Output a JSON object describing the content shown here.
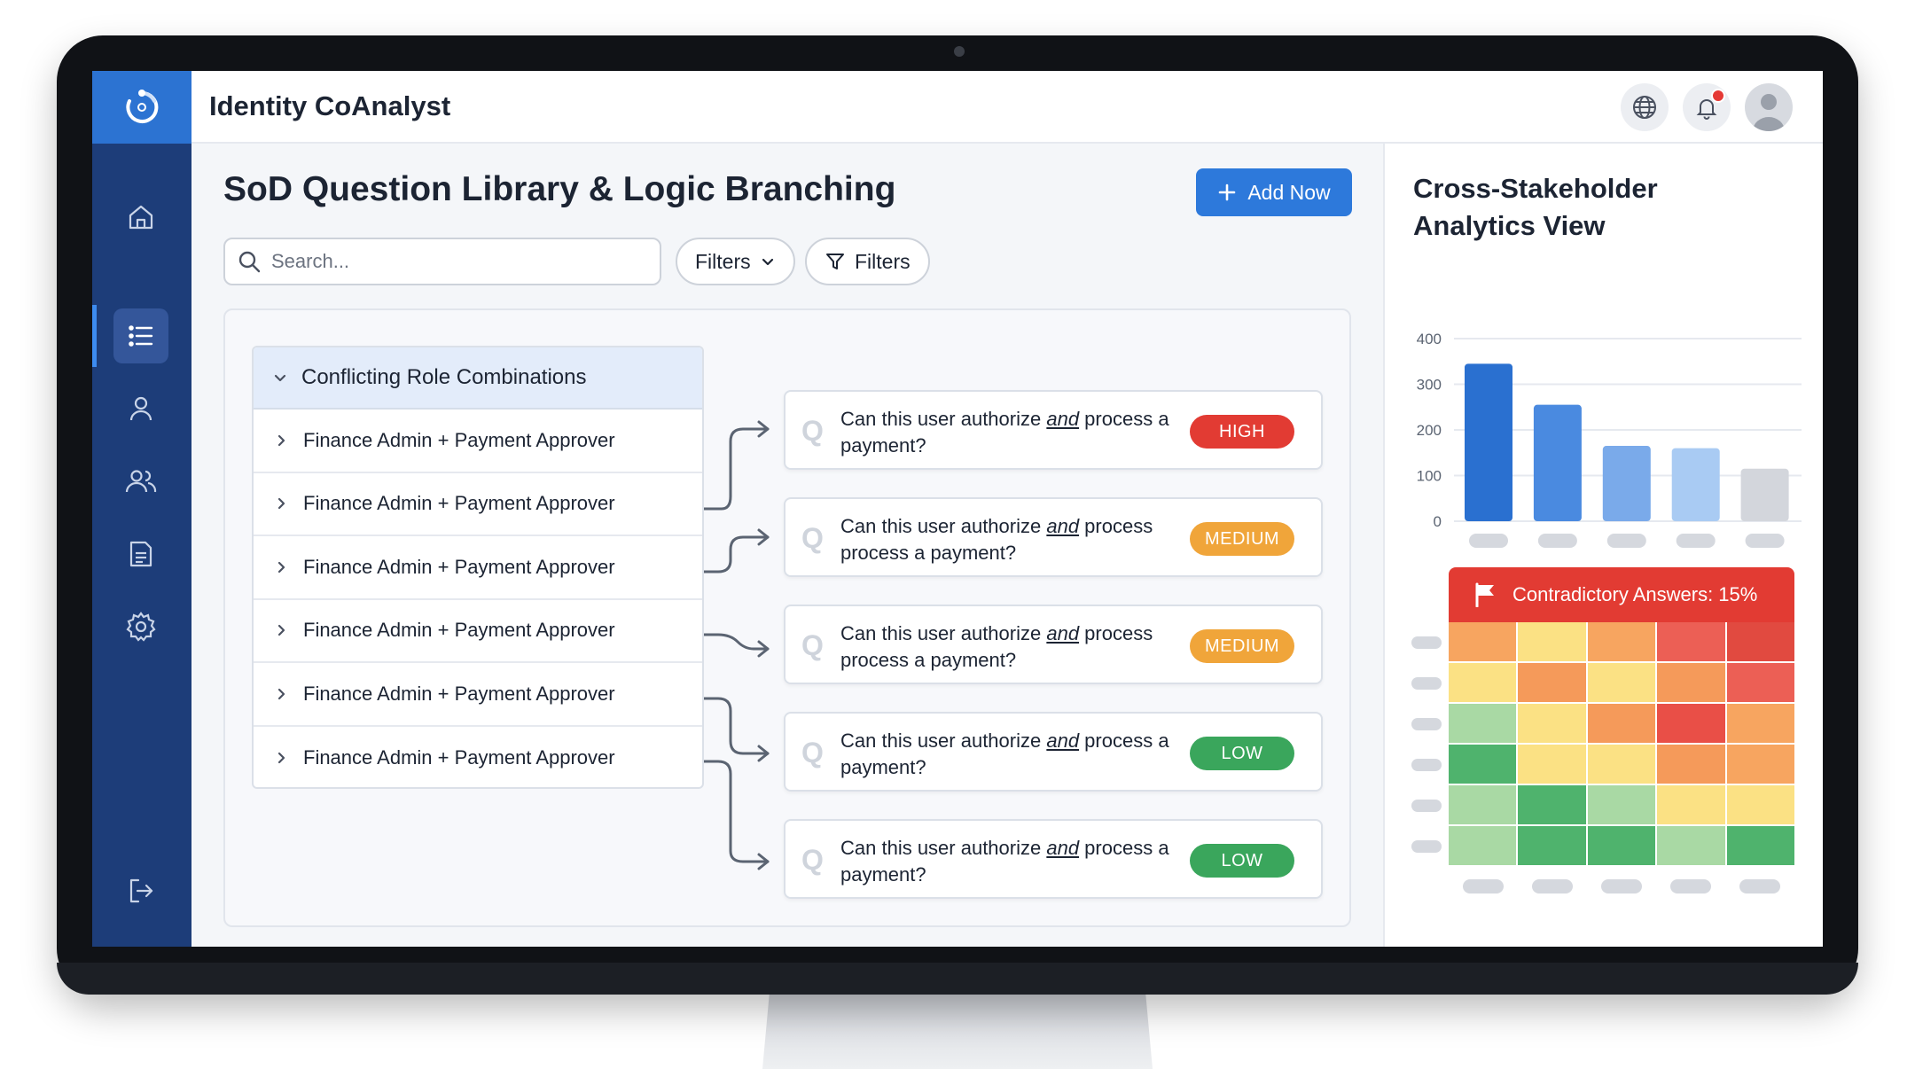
{
  "app": {
    "title": "Identity CoAnalyst"
  },
  "page": {
    "title": "SoD Question Library & Logic Branching"
  },
  "toolbar": {
    "add_label": "Add Now",
    "search_placeholder": "Search...",
    "filter_dropdown_label": "Filters",
    "filter_button_label": "Filters"
  },
  "roles": {
    "header": "Conflicting Role Combinations",
    "items": [
      "Finance Admin + Payment Approver",
      "Finance Admin + Payment Approver",
      "Finance Admin + Payment Approver",
      "Finance Admin + Payment Approver",
      "Finance Admin + Payment Approver",
      "Finance Admin + Payment Approver"
    ]
  },
  "questions": [
    {
      "mark": "Q",
      "pre": "Can this user authorize ",
      "em": "and",
      "post": " process a payment?",
      "risk": "HIGH",
      "color": "#e23b33"
    },
    {
      "mark": "Q",
      "pre": "Can this user authorize ",
      "em": "and",
      "post": " process process a payment?",
      "risk": "MEDIUM",
      "color": "#f0a53a"
    },
    {
      "mark": "Q",
      "pre": "Can this user authorize ",
      "em": "and",
      "post": " process process a payment?",
      "risk": "MEDIUM",
      "color": "#f0a53a"
    },
    {
      "mark": "Q",
      "pre": "Can this user authorize ",
      "em": "and",
      "post": " process a payment?",
      "risk": "LOW",
      "color": "#3aa65c"
    },
    {
      "mark": "Q",
      "pre": "Can this user authorize ",
      "em": "and",
      "post": " process a payment?",
      "risk": "LOW",
      "color": "#3aa65c"
    }
  ],
  "analytics": {
    "title": "Cross-Stakeholder Analytics View",
    "heatmap_title": "Contradictory Answers: 15%"
  },
  "chart_data": [
    {
      "type": "bar",
      "categories": [
        "",
        "",
        "",
        "",
        ""
      ],
      "values": [
        345,
        255,
        165,
        160,
        115
      ],
      "colors": [
        "#2a70d0",
        "#4a8ae0",
        "#7aaaea",
        "#a9cbf3",
        "#d3d6dc"
      ],
      "yticks": [
        0,
        100,
        200,
        300,
        400
      ],
      "ylim": [
        0,
        400
      ],
      "grid": true
    },
    {
      "type": "heatmap",
      "title": "Contradictory Answers: 15%",
      "rows": 6,
      "cols": 5,
      "cells": [
        [
          "#f7a560",
          "#fbe184",
          "#f7a560",
          "#ec5f55",
          "#e14a40"
        ],
        [
          "#fbe184",
          "#f59a5a",
          "#fbe184",
          "#f59a5a",
          "#ec5f55"
        ],
        [
          "#a9d9a4",
          "#fbe184",
          "#f59a5a",
          "#e94f47",
          "#f7a560"
        ],
        [
          "#4fb36d",
          "#fbe184",
          "#fbe184",
          "#f59a5a",
          "#f7a560"
        ],
        [
          "#a9d9a4",
          "#4fb36d",
          "#a9d9a4",
          "#fbe184",
          "#fbe184"
        ],
        [
          "#a9d9a4",
          "#4fb36d",
          "#4fb36d",
          "#a9d9a4",
          "#4fb36d"
        ]
      ]
    }
  ],
  "icons": {
    "logo": "refresh-logo-icon",
    "nav": [
      "home-icon",
      "list-icon",
      "user-icon",
      "users-icon",
      "document-icon",
      "gear-icon",
      "logout-icon"
    ],
    "top": [
      "globe-icon",
      "bell-icon",
      "avatar-icon"
    ]
  },
  "colors": {
    "sidebar": "#1d3d79",
    "accent": "#2d79db",
    "high": "#e23b33",
    "medium": "#f0a53a",
    "low": "#3aa65c"
  }
}
